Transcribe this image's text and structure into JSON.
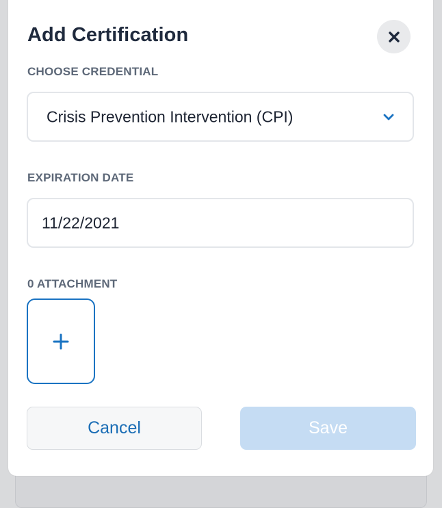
{
  "dialog": {
    "title": "Add Certification",
    "close_icon": "close-icon"
  },
  "credential": {
    "label": "CHOOSE CREDENTIAL",
    "selected": "Crisis Prevention Intervention (CPI)",
    "dropdown_icon": "chevron-down-icon"
  },
  "expiration": {
    "label": "EXPIRATION DATE",
    "value": "11/22/2021"
  },
  "attachments": {
    "label": "0 ATTACHMENT",
    "add_icon": "plus-icon"
  },
  "actions": {
    "cancel_label": "Cancel",
    "save_label": "Save"
  },
  "colors": {
    "accent": "#1a73c2",
    "title": "#1f2a3d",
    "label": "#5d6878",
    "save_disabled": "#c5dcf3"
  }
}
